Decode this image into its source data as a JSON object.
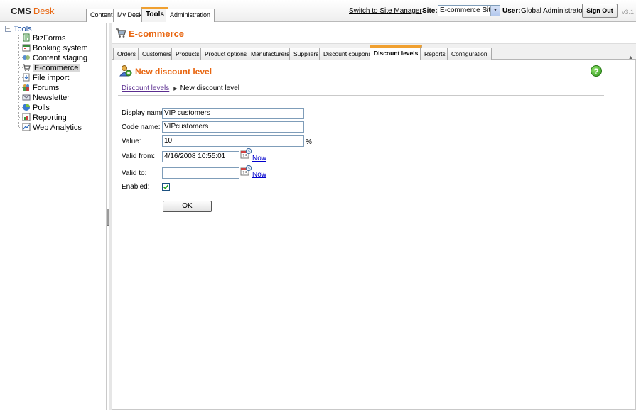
{
  "header": {
    "logo_cms": "CMS",
    "logo_desk": "Desk",
    "tabs": [
      {
        "label": "Content"
      },
      {
        "label": "My Desk"
      },
      {
        "label": "Tools",
        "active": true
      },
      {
        "label": "Administration"
      }
    ],
    "site_manager_link": "Switch to Site Manager",
    "site_label": "Site:",
    "site_value": "E-commerce Site",
    "user_label": "User:",
    "user_name": "Global Administrator",
    "signout_label": "Sign Out",
    "version": "v3.1"
  },
  "tree": {
    "root": "Tools",
    "items": [
      {
        "label": "BizForms",
        "icon": "bizforms-icon"
      },
      {
        "label": "Booking system",
        "icon": "booking-icon"
      },
      {
        "label": "Content staging",
        "icon": "staging-icon"
      },
      {
        "label": "E-commerce",
        "icon": "ecommerce-icon",
        "selected": true
      },
      {
        "label": "File import",
        "icon": "file-import-icon"
      },
      {
        "label": "Forums",
        "icon": "forums-icon"
      },
      {
        "label": "Newsletter",
        "icon": "newsletter-icon"
      },
      {
        "label": "Polls",
        "icon": "polls-icon"
      },
      {
        "label": "Reporting",
        "icon": "reporting-icon"
      },
      {
        "label": "Web Analytics",
        "icon": "analytics-icon"
      }
    ]
  },
  "module": {
    "title": "E-commerce",
    "tabs": [
      {
        "label": "Orders"
      },
      {
        "label": "Customers"
      },
      {
        "label": "Products"
      },
      {
        "label": "Product options"
      },
      {
        "label": "Manufacturers"
      },
      {
        "label": "Suppliers"
      },
      {
        "label": "Discount coupons"
      },
      {
        "label": "Discount levels",
        "active": true
      },
      {
        "label": "Reports"
      },
      {
        "label": "Configuration"
      }
    ]
  },
  "page": {
    "title": "New discount level",
    "breadcrumb_link": "Discount levels",
    "breadcrumb_current": "New discount level",
    "fields": {
      "display_name_label": "Display name:",
      "display_name_value": "VIP customers",
      "code_name_label": "Code name:",
      "code_name_value": "VIPcustomers",
      "value_label": "Value:",
      "value_value": "10",
      "value_unit": "%",
      "valid_from_label": "Valid from:",
      "valid_from_value": "4/16/2008 10:55:01",
      "valid_to_label": "Valid to:",
      "valid_to_value": "",
      "now_label": "Now",
      "enabled_label": "Enabled:",
      "enabled_checked": true
    },
    "ok_label": "OK"
  },
  "colors": {
    "accent_orange": "#e8650f",
    "tab_active_border": "#f0a030",
    "link_purple": "#5b2e90",
    "link_blue": "#0000cc"
  }
}
